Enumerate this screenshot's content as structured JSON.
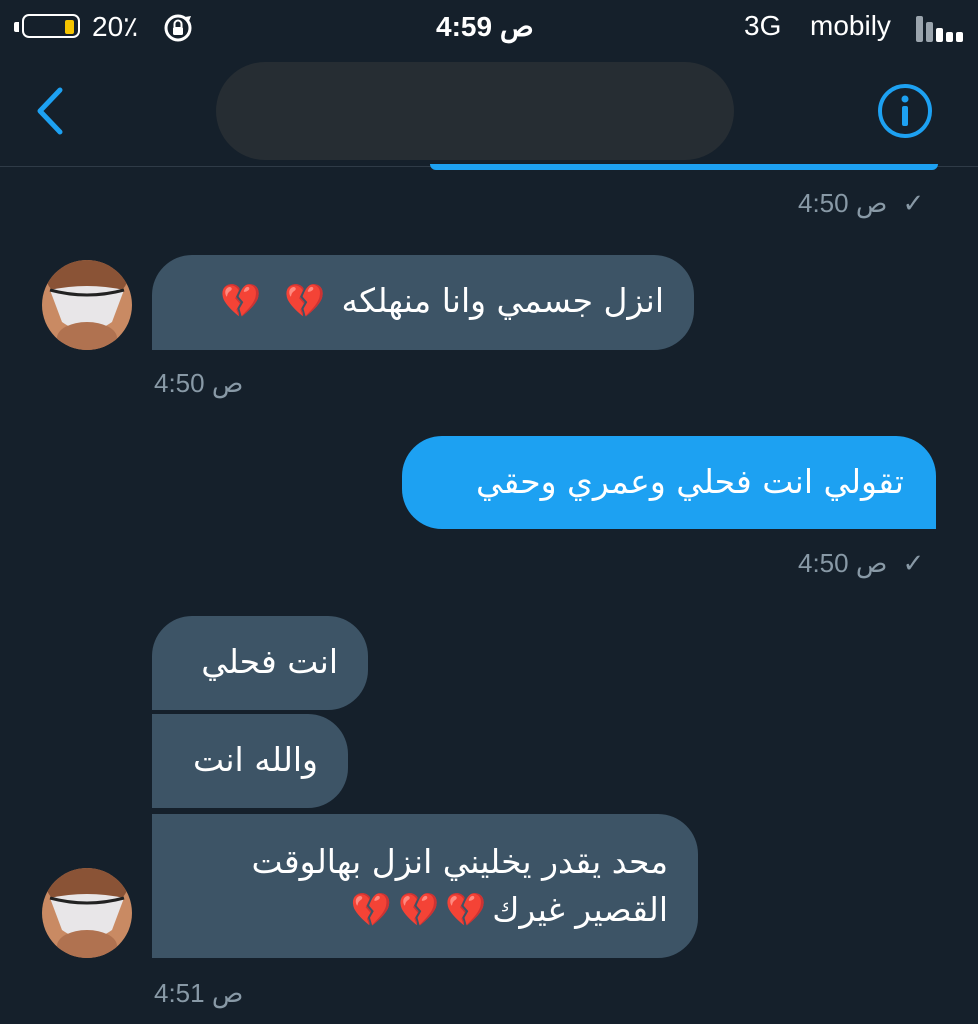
{
  "status_bar": {
    "battery_percent": "20٪",
    "time": "4:59 ص",
    "network": "3G",
    "carrier": "mobily",
    "battery_level": 0.2,
    "battery_color": "#f5c400"
  },
  "nav": {
    "back_icon": "chevron-left-icon",
    "info_icon": "info-icon",
    "accent": "#1da1f2"
  },
  "messages": [
    {
      "side": "out",
      "timestamp": "4:50 ص",
      "read_mark": "✓"
    },
    {
      "side": "in",
      "text": "انزل جسمي وانا منهلكه",
      "emoji": "💔 💔",
      "timestamp": "4:50 ص"
    },
    {
      "side": "out",
      "text": "تقولي انت فحلي وعمري وحقي",
      "timestamp": "4:50 ص",
      "read_mark": "✓"
    },
    {
      "side": "in",
      "text": "انت فحلي"
    },
    {
      "side": "in",
      "text": "والله انت"
    },
    {
      "side": "in",
      "text_line1": "محد يقدر يخليني انزل بهالوقت",
      "text_line2": "القصير غيرك",
      "emoji": "💔💔💔",
      "timestamp": "4:51 ص"
    }
  ],
  "colors": {
    "background": "#15202b",
    "incoming_bubble": "#3d5466",
    "outgoing_bubble": "#1da1f2",
    "timestamp": "#8899a6"
  }
}
